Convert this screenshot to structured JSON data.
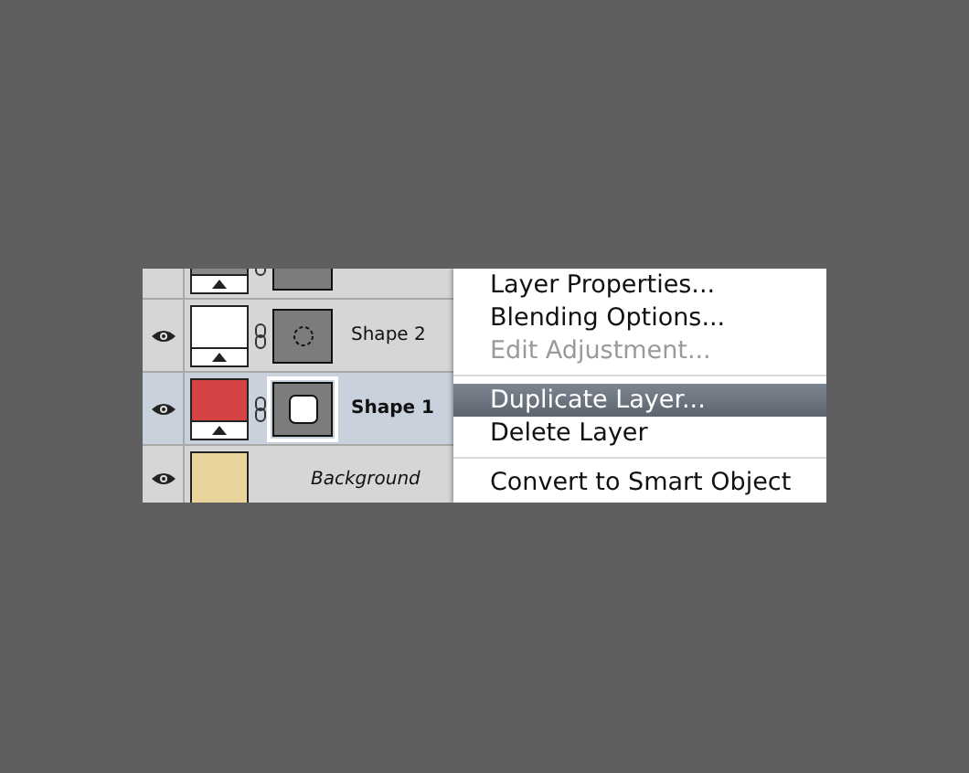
{
  "layers": [
    {
      "kind": "shape",
      "color": "#888888",
      "selected": false
    },
    {
      "kind": "ellipse",
      "name": "Shape 2",
      "color": "#ffffff",
      "selected": false
    },
    {
      "kind": "rectangle",
      "name": "Shape 1",
      "color": "#d44444",
      "selected": true
    },
    {
      "kind": "background",
      "name": "Background",
      "color": "#e9d59c",
      "selected": false
    }
  ],
  "menu": [
    {
      "kind": "item",
      "label": "Layer Properties...",
      "disabled": false,
      "selected": false
    },
    {
      "kind": "item",
      "label": "Blending Options...",
      "disabled": false,
      "selected": false
    },
    {
      "kind": "item",
      "label": "Edit Adjustment...",
      "disabled": true,
      "selected": false
    },
    {
      "kind": "separator"
    },
    {
      "kind": "item",
      "label": "Duplicate Layer...",
      "disabled": false,
      "selected": true
    },
    {
      "kind": "item",
      "label": "Delete Layer",
      "disabled": false,
      "selected": false
    },
    {
      "kind": "separator"
    },
    {
      "kind": "item",
      "label": "Convert to Smart Object",
      "disabled": false,
      "selected": false
    }
  ]
}
